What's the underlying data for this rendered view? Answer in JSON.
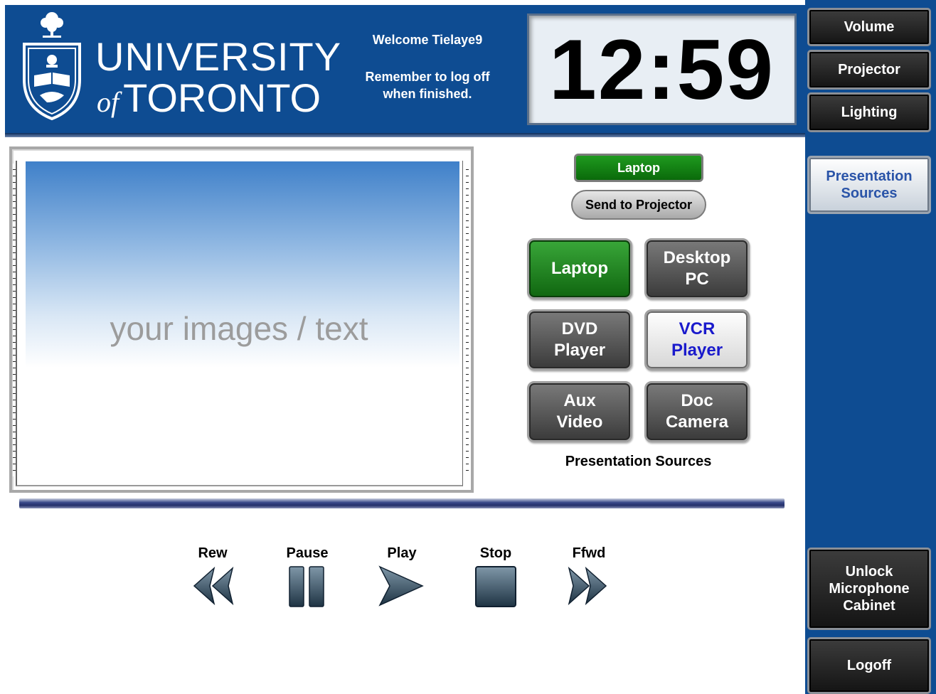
{
  "header": {
    "university_line1": "UNIVERSITY",
    "university_of": "of",
    "university_line2": "TORONTO",
    "welcome": "Welcome Tielaye9",
    "reminder_line1": "Remember to log off",
    "reminder_line2": "when finished.",
    "clock": "12:59"
  },
  "sidebar": {
    "volume": "Volume",
    "projector": "Projector",
    "lighting": "Lighting",
    "presentation_sources_line1": "Presentation",
    "presentation_sources_line2": "Sources",
    "unlock_line1": "Unlock",
    "unlock_line2": "Microphone",
    "unlock_line3": "Cabinet",
    "logoff": "Logoff"
  },
  "preview": {
    "placeholder": "your images / text"
  },
  "sources": {
    "current": "Laptop",
    "send_to_projector": "Send to Projector",
    "laptop": "Laptop",
    "desktop_line1": "Desktop",
    "desktop_line2": "PC",
    "dvd_line1": "DVD",
    "dvd_line2": "Player",
    "vcr_line1": "VCR",
    "vcr_line2": "Player",
    "aux_line1": "Aux",
    "aux_line2": "Video",
    "doc_line1": "Doc",
    "doc_line2": "Camera",
    "caption": "Presentation Sources"
  },
  "transport": {
    "rew": "Rew",
    "pause": "Pause",
    "play": "Play",
    "stop": "Stop",
    "ffwd": "Ffwd"
  },
  "colors": {
    "brand_blue": "#0e4c92",
    "active_source_green": "#1f9a1f"
  },
  "icons": {
    "crest": "university-crest-icon",
    "rew": "rewind-icon",
    "pause": "pause-icon",
    "play": "play-icon",
    "stop": "stop-icon",
    "ffwd": "fast-forward-icon"
  }
}
